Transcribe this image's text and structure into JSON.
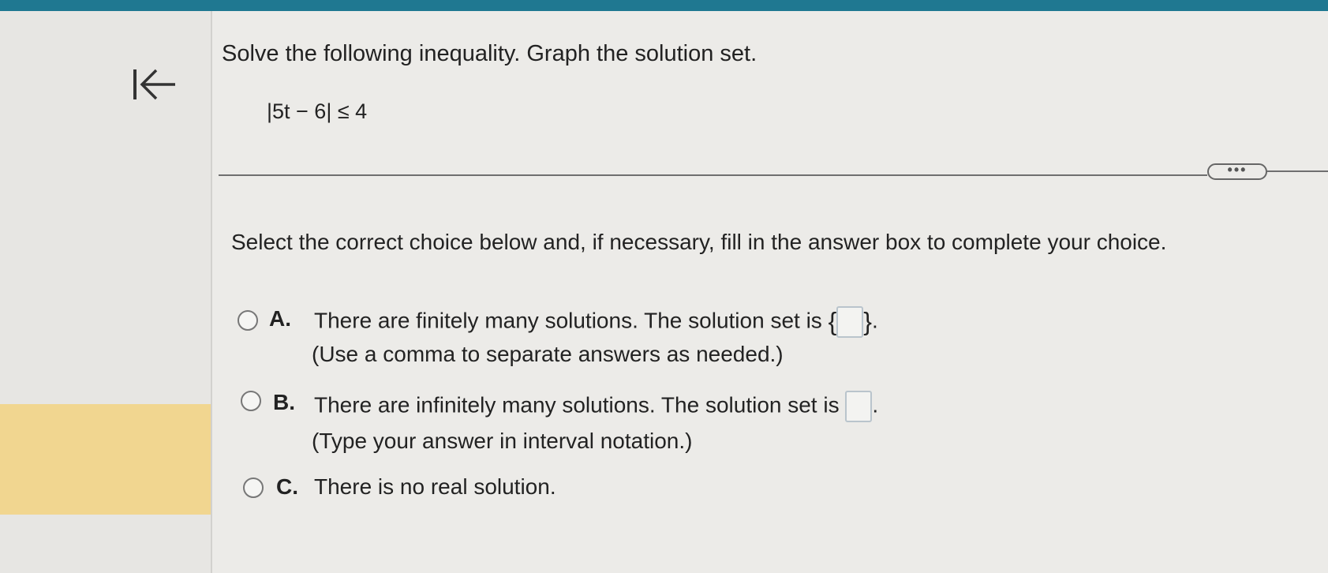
{
  "header": {
    "accent_color": "#1f7891"
  },
  "navigation": {
    "back_icon": "arrow-left-to-bar-icon"
  },
  "question": {
    "instruction": "Solve the following inequality. Graph the solution set.",
    "equation": "|5t − 6| ≤ 4"
  },
  "more_button": {
    "label": "•••"
  },
  "prompt": "Select the correct choice below and, if necessary, fill in the answer box to complete your choice.",
  "choices": [
    {
      "letter": "A.",
      "text": "There are finitely many solutions. The solution set is",
      "brace_open": "{",
      "brace_close": "}",
      "suffix": ".",
      "hint": "(Use a comma to separate answers as needed.)"
    },
    {
      "letter": "B.",
      "text": "There are infinitely many solutions. The solution set is",
      "suffix": ".",
      "hint": "(Type your answer in interval notation.)"
    },
    {
      "letter": "C.",
      "text": "There is no real solution."
    }
  ],
  "colors": {
    "sidebar_highlight": "#f1d690",
    "input_border": "#b9c4cc"
  }
}
